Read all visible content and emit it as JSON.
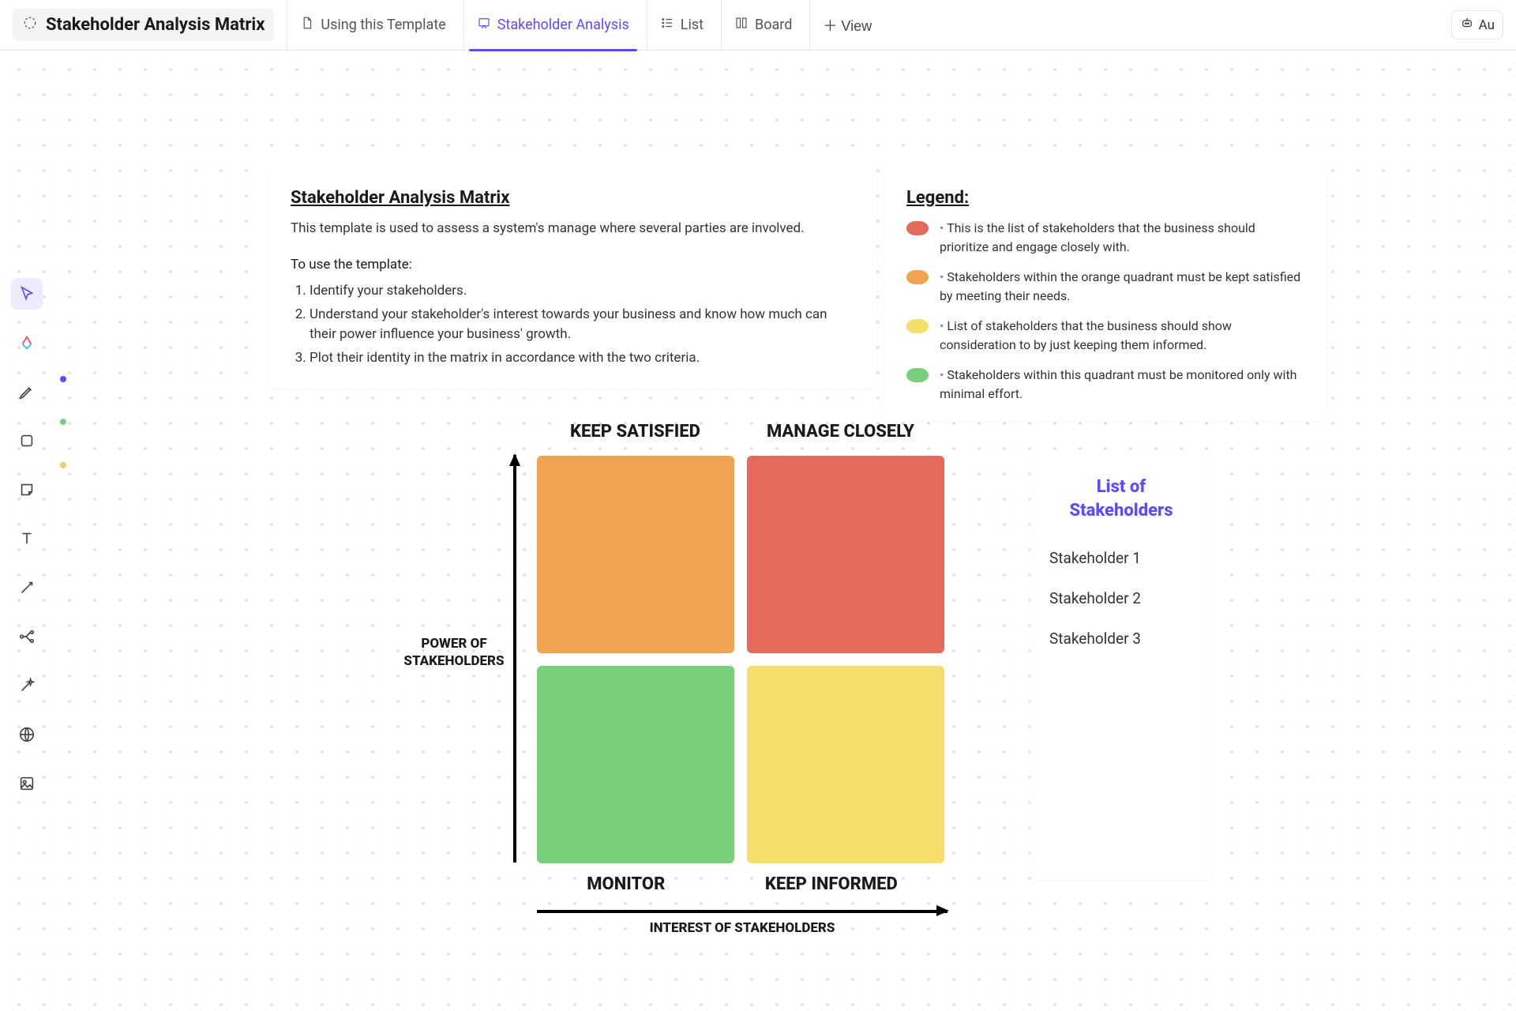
{
  "header": {
    "title": "Stakeholder Analysis Matrix",
    "tabs": [
      {
        "label": "Using this Template",
        "active": false
      },
      {
        "label": "Stakeholder Analysis",
        "active": true
      },
      {
        "label": "List",
        "active": false
      },
      {
        "label": "Board",
        "active": false
      }
    ],
    "add_view_label": "View",
    "ai_label": "Au"
  },
  "info": {
    "title": "Stakeholder Analysis Matrix",
    "lead": "This template is used to assess a system's manage where several parties are involved.",
    "howto_lead": "To use the template:",
    "steps": [
      "Identify your stakeholders.",
      "Understand your stakeholder's interest towards your business and know how much can their power influence your business' growth.",
      "Plot their identity in the matrix in accordance with the two criteria."
    ]
  },
  "legend": {
    "title": "Legend:",
    "items": [
      {
        "color": "red",
        "text": "This is the list of stakeholders that the business should prioritize and engage closely with."
      },
      {
        "color": "orange",
        "text": "Stakeholders within the orange quadrant must be kept satisfied by meeting their needs."
      },
      {
        "color": "yellow",
        "text": "List of stakeholders that the business should show consideration to by just keeping them informed."
      },
      {
        "color": "green",
        "text": "Stakeholders within this quadrant must be monitored only with minimal effort."
      }
    ]
  },
  "matrix": {
    "top_left": "KEEP SATISFIED",
    "top_right": "MANAGE CLOSELY",
    "bottom_left": "MONITOR",
    "bottom_right": "KEEP INFORMED",
    "y_axis": "POWER OF STAKEHOLDERS",
    "x_axis": "INTEREST OF STAKEHOLDERS"
  },
  "list": {
    "title": "List of Stakeholders",
    "items": [
      "Stakeholder 1",
      "Stakeholder 2",
      "Stakeholder 3"
    ]
  },
  "tools": [
    "pointer",
    "sparkle",
    "pen",
    "square",
    "sticky",
    "text",
    "connector",
    "branch",
    "magic",
    "globe",
    "image"
  ]
}
